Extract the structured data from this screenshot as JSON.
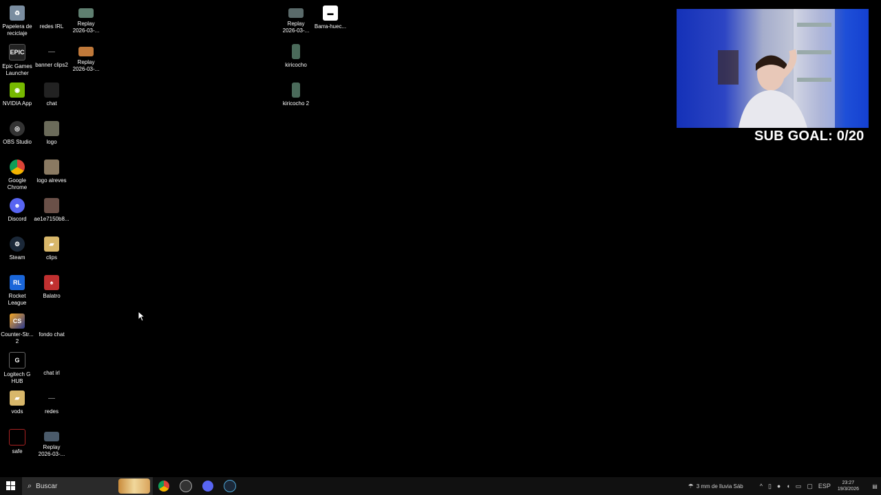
{
  "desktop_icons": [
    {
      "label": "Papelera de\nreciclaje",
      "icon": "recycle-bin-icon"
    },
    {
      "label": "Epic Games\nLauncher",
      "icon": "epic-games-icon"
    },
    {
      "label": "NVIDIA App",
      "icon": "nvidia-icon"
    },
    {
      "label": "OBS Studio",
      "icon": "obs-icon"
    },
    {
      "label": "Google\nChrome",
      "icon": "chrome-icon"
    },
    {
      "label": "Discord",
      "icon": "discord-icon"
    },
    {
      "label": "Steam",
      "icon": "steam-icon"
    },
    {
      "label": "Rocket\nLeague",
      "icon": "rocket-league-icon"
    },
    {
      "label": "Counter-Str...\n2",
      "icon": "counter-strike-icon"
    },
    {
      "label": "Logitech G\nHUB",
      "icon": "logitech-icon"
    },
    {
      "label": "vods",
      "icon": "folder-icon"
    },
    {
      "label": "safe",
      "icon": "file-icon"
    },
    {
      "label": "redes IRL",
      "icon": "file-icon"
    },
    {
      "label": "banner clips2",
      "icon": "image-file-icon"
    },
    {
      "label": "chat",
      "icon": "image-file-icon"
    },
    {
      "label": "logo",
      "icon": "image-file-icon"
    },
    {
      "label": "logo alreves",
      "icon": "image-file-icon"
    },
    {
      "label": "ae1e7150b8...",
      "icon": "image-file-icon"
    },
    {
      "label": "clips",
      "icon": "folder-icon"
    },
    {
      "label": "Balatro",
      "icon": "balatro-icon"
    },
    {
      "label": "fondo chat",
      "icon": "image-file-icon"
    },
    {
      "label": "chat irl",
      "icon": "image-file-icon"
    },
    {
      "label": "redes",
      "icon": "image-file-icon"
    },
    {
      "label": "Replay\n2026-03-...",
      "icon": "video-file-icon"
    },
    {
      "label": "Replay\n2026-03-...",
      "icon": "video-file-icon"
    },
    {
      "label": "Replay\n2026-03-...",
      "icon": "video-file-icon"
    },
    {
      "label": "Replay\n2026-03-...",
      "icon": "video-file-icon"
    },
    {
      "label": "kiricocho",
      "icon": "image-file-icon"
    },
    {
      "label": "kiricocho 2",
      "icon": "image-file-icon"
    },
    {
      "label": "Barra-huec...",
      "icon": "image-file-icon"
    }
  ],
  "overlay": {
    "sub_goal": "SUB GOAL: 0/20"
  },
  "taskbar": {
    "search_placeholder": "Buscar",
    "weather": "3 mm de lluvia Sáb",
    "language": "ESP",
    "time": "23:27",
    "date": "19/3/2026"
  }
}
